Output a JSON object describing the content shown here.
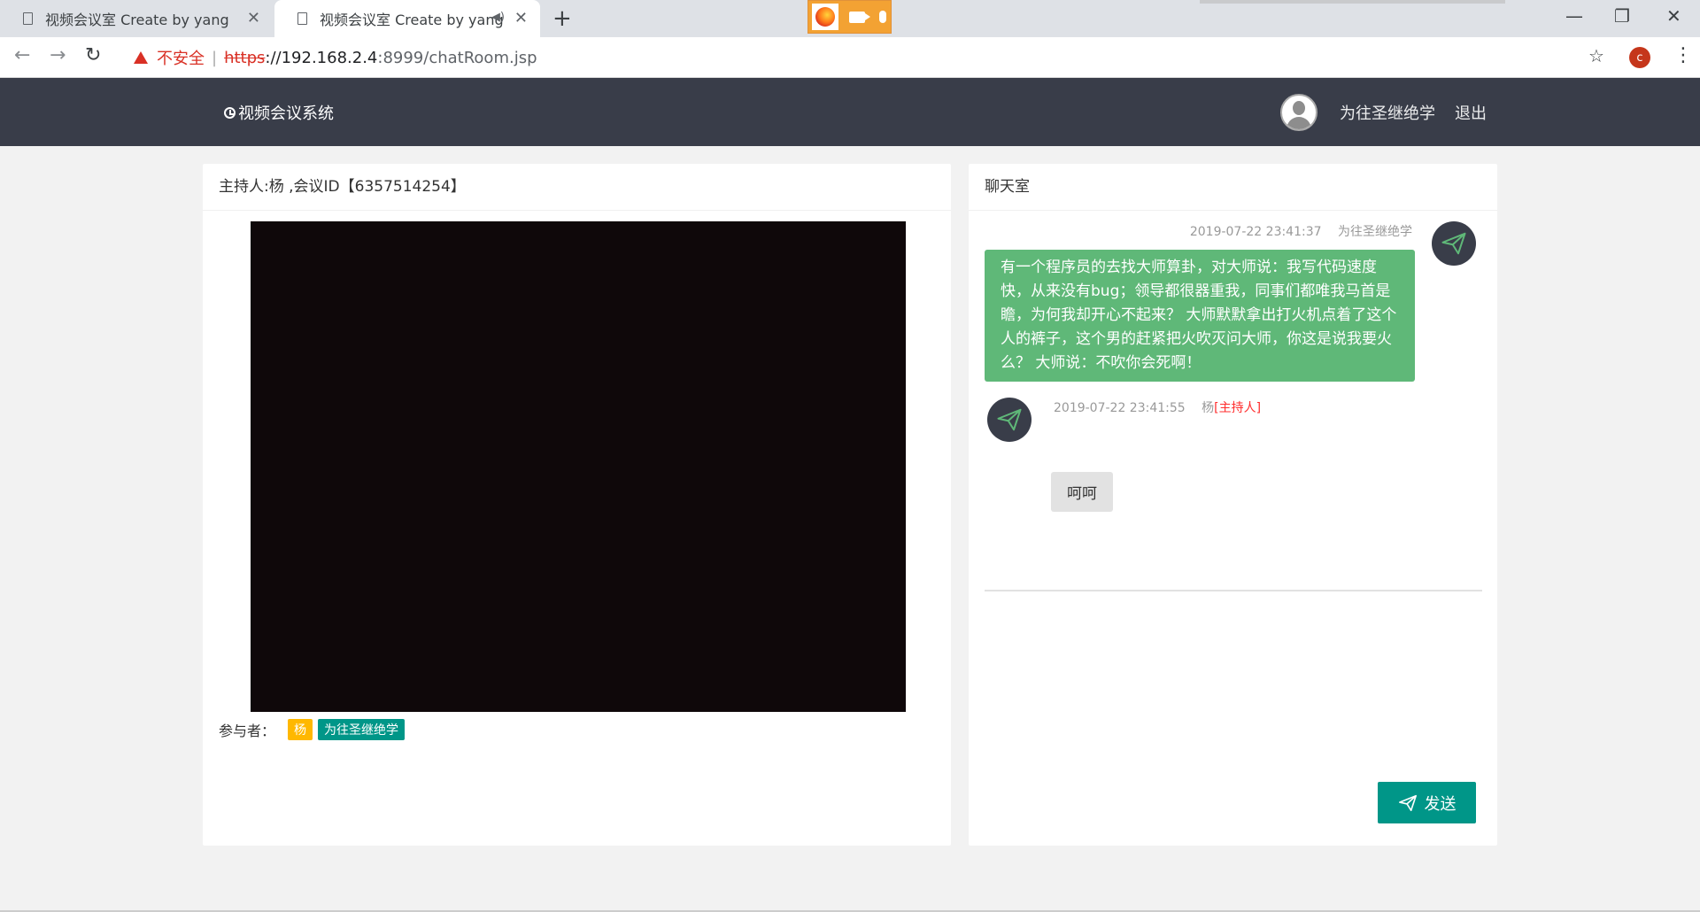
{
  "browser": {
    "tabs": [
      {
        "title": "视频会议室 Create by yang",
        "active": false
      },
      {
        "title": "视频会议室 Create by yang",
        "active": true,
        "audio": "audio-icon"
      }
    ],
    "address": {
      "security_label": "不安全",
      "scheme": "https",
      "host": "://192.168.2.4",
      "path": ":8999/chatRoom.jsp"
    },
    "profile_initial": "c"
  },
  "app": {
    "brand": "视频会议系统",
    "user_name": "为往圣继绝学",
    "logout": "退出"
  },
  "meeting": {
    "header": "主持人:杨 ,会议ID【6357514254】",
    "participants_label": "参与者：",
    "participants": [
      "杨",
      "为往圣继绝学"
    ]
  },
  "chat": {
    "title": "聊天室",
    "messages": [
      {
        "time": "2019-07-22 23:41:37",
        "sender": "为往圣继绝学",
        "text": "有一个程序员的去找大师算卦，对大师说：我写代码速度快，从来没有bug；领导都很器重我，同事们都唯我马首是瞻，为何我却开心不起来？ 大师默默拿出打火机点着了这个人的裤子，这个男的赶紧把火吹灭问大师，你这是说我要火么？ 大师说：不吹你会死啊！",
        "side": "right"
      },
      {
        "time": "2019-07-22 23:41:55",
        "sender": "杨",
        "role_tag": "[主持人]",
        "text": "呵呵",
        "side": "left"
      }
    ],
    "send_label": "发送"
  },
  "colors": {
    "header_bg": "#393d49",
    "bubble_self": "#5fb878",
    "tag_orange": "#ffb800",
    "tag_teal": "#009688",
    "send_button": "#009688"
  }
}
